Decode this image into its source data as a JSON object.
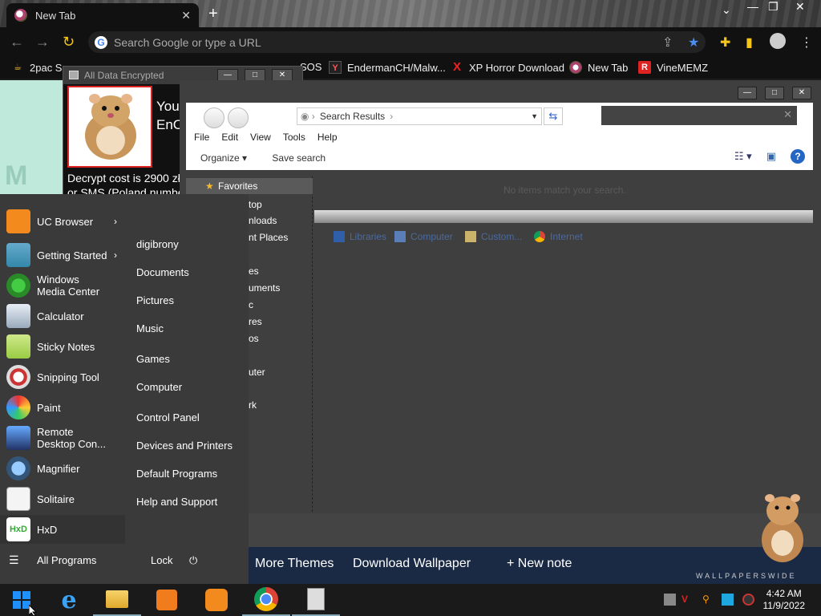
{
  "browser": {
    "tab_title": "New Tab",
    "new_tab_glyph": "+",
    "omnibox_placeholder": "Search Google or type a URL",
    "bookmarks": [
      {
        "label": "2pac S",
        "icon": "chrome-favicon"
      },
      {
        "label": "SOS",
        "icon": "folder-icon"
      },
      {
        "label": "EndermanCH/Malw...",
        "icon": "yp-icon"
      },
      {
        "label": "XP Horror Download",
        "icon": "x-icon"
      },
      {
        "label": "New Tab",
        "icon": "newtab-favicon"
      },
      {
        "label": "VineMEMZ",
        "icon": "r-icon"
      }
    ]
  },
  "ransom_window": {
    "title": "All Data Encrypted",
    "heading_line1": "You",
    "heading_line2": "EnC",
    "text_line1": "Decrypt cost is 2900 zło",
    "text_line2": "or SMS (Poland numbe"
  },
  "explorer": {
    "address_crumb": "Search Results",
    "menu": [
      "File",
      "Edit",
      "View",
      "Tools",
      "Help"
    ],
    "organize_label": "Organize",
    "save_search_label": "Save search",
    "favorites_label": "Favorites",
    "nav_fragments": [
      "top",
      "nloads",
      "nt Places",
      "es",
      "uments",
      "c",
      "res",
      "os",
      "uter",
      "rk"
    ],
    "no_items_text": "No items match your search.",
    "search_again_items": [
      "Libraries",
      "Computer",
      "Custom...",
      "Internet"
    ]
  },
  "start_menu": {
    "programs": [
      {
        "label": "UC Browser",
        "arrow": true
      },
      {
        "label": "Getting Started",
        "arrow": true
      },
      {
        "label": "Windows\nMedia Center",
        "arrow": false
      },
      {
        "label": "Calculator",
        "arrow": false
      },
      {
        "label": "Sticky Notes",
        "arrow": false
      },
      {
        "label": "Snipping Tool",
        "arrow": false
      },
      {
        "label": "Paint",
        "arrow": false
      },
      {
        "label": "Remote\nDesktop Con...",
        "arrow": false
      },
      {
        "label": "Magnifier",
        "arrow": false
      },
      {
        "label": "Solitaire",
        "arrow": false
      },
      {
        "label": "HxD",
        "arrow": false
      }
    ],
    "all_programs_label": "All Programs",
    "right_links": [
      "digibrony",
      "Documents",
      "Pictures",
      "Music",
      "Games",
      "Computer",
      "Control Panel",
      "Devices and Printers",
      "Default Programs",
      "Help and Support"
    ],
    "lock_label": "Lock"
  },
  "wallpaper_links": [
    "More Themes",
    "Download Wallpaper",
    "+ New note"
  ],
  "wallpaper_brand": "WALLPAPERSWIDE",
  "taskbar": {
    "time": "4:42 AM",
    "date": "11/9/2022"
  }
}
